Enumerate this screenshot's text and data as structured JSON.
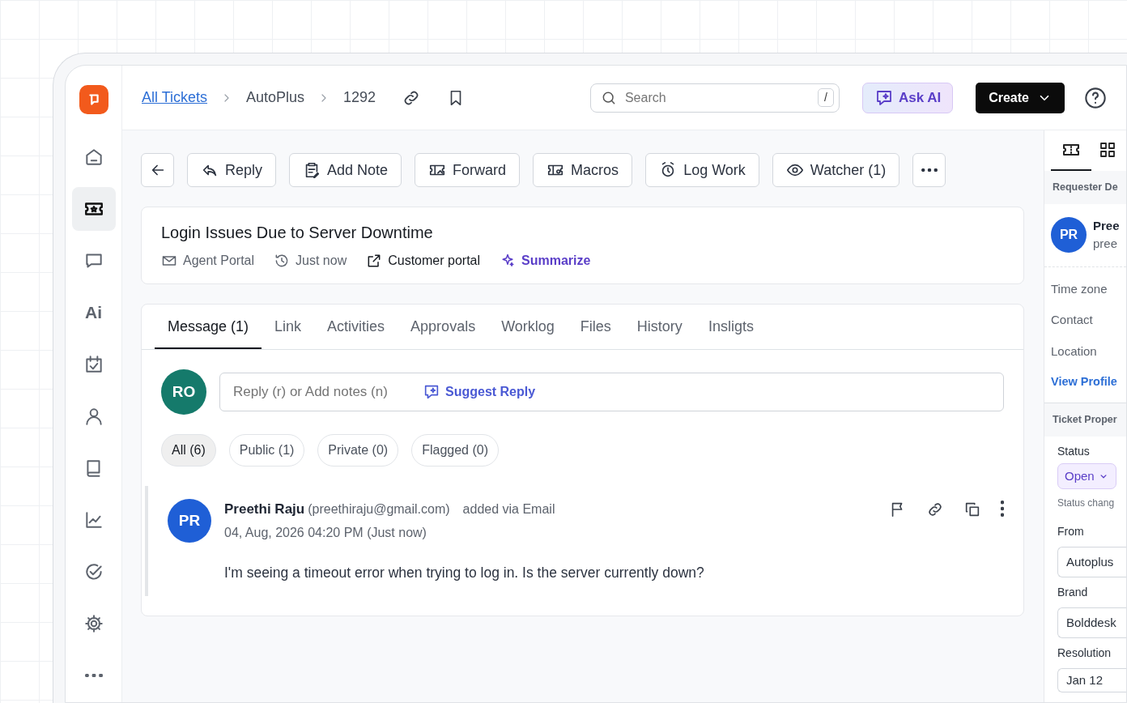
{
  "sidebar": {
    "items": [
      {
        "selected": false
      },
      {
        "selected": true
      },
      {
        "selected": false
      },
      {
        "selected": false,
        "label": "Ai"
      },
      {
        "selected": false
      },
      {
        "selected": false
      },
      {
        "selected": false
      },
      {
        "selected": false
      },
      {
        "selected": false
      },
      {
        "selected": false
      },
      {
        "selected": false
      }
    ]
  },
  "breadcrumb": [
    {
      "label": "All Tickets",
      "kind": "link"
    },
    {
      "label": "AutoPlus",
      "kind": "text"
    },
    {
      "label": "1292",
      "kind": "text"
    }
  ],
  "search": {
    "placeholder": "Search",
    "shortcut": "/"
  },
  "ask_ai": {
    "label": "Ask AI"
  },
  "create": {
    "label": "Create"
  },
  "toolbar": {
    "buttons": [
      {
        "label": "Reply"
      },
      {
        "label": "Add Note"
      },
      {
        "label": "Forward"
      },
      {
        "label": "Macros"
      },
      {
        "label": "Log Work"
      },
      {
        "label": "Watcher (1)"
      }
    ]
  },
  "ticket": {
    "title": "Login Issues Due to Server Downtime",
    "meta": [
      {
        "label": "Agent Portal",
        "kind": "plain"
      },
      {
        "label": "Just now",
        "kind": "plain"
      },
      {
        "label": "Customer portal",
        "kind": "link"
      },
      {
        "label": "Summarize",
        "kind": "ai"
      }
    ]
  },
  "tabs": [
    {
      "label": "Message (1)",
      "selected": true
    },
    {
      "label": "Link",
      "selected": false
    },
    {
      "label": "Activities",
      "selected": false
    },
    {
      "label": "Approvals",
      "selected": false
    },
    {
      "label": "Worklog",
      "selected": false
    },
    {
      "label": "Files",
      "selected": false
    },
    {
      "label": "History",
      "selected": false
    },
    {
      "label": "Insligts",
      "selected": false
    }
  ],
  "composer": {
    "avatar": "RO",
    "placeholder": "Reply (r) or Add notes (n)",
    "suggest": "Suggest Reply"
  },
  "filters": [
    {
      "label": "All (6)",
      "selected": true
    },
    {
      "label": "Public (1)",
      "selected": false
    },
    {
      "label": "Private (0)",
      "selected": false
    },
    {
      "label": "Flagged (0)",
      "selected": false
    }
  ],
  "message": {
    "avatar": "PR",
    "author": "Preethi Raju",
    "email": "(preethiraju@gmail.com)",
    "via": "added via Email",
    "time": "04, Aug, 2026 04:20 PM (Just now)",
    "body": "I'm seeing a timeout error when trying to log in. Is the server currently down?"
  },
  "right_panel": {
    "tabs": [
      {
        "selected": true
      },
      {
        "selected": false
      }
    ],
    "requester_heading": "Requester De",
    "requester": {
      "avatar": "PR",
      "name": "Pree",
      "email": "pree"
    },
    "fields": [
      "Time zone",
      "Contact",
      "Location"
    ],
    "view_profile": "View Profile",
    "properties_heading": "Ticket Proper",
    "status": {
      "label": "Status",
      "value": "Open",
      "note": "Status chang"
    },
    "properties": [
      {
        "label": "From",
        "value": "Autoplus"
      },
      {
        "label": "Brand",
        "value": "Bolddesk"
      },
      {
        "label": "Resolution",
        "value": "Jan 12"
      }
    ]
  }
}
